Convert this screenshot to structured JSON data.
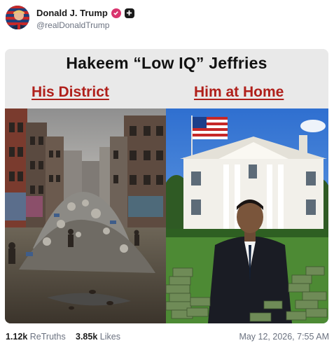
{
  "post": {
    "author_name": "Donald J. Trump",
    "handle": "@realDonaldTrump",
    "verified_icon": "verified-badge-icon",
    "platform_icon": "truth-social-icon"
  },
  "meme": {
    "title": "Hakeem “Low IQ” Jeffries",
    "left_caption": "His District",
    "right_caption": "Him at Home"
  },
  "stats": {
    "retruths_count": "1.12k",
    "retruths_label": "ReTruths",
    "likes_count": "3.85k",
    "likes_label": "Likes",
    "timestamp": "May 12, 2026, 7:55 AM"
  },
  "colors": {
    "caption_red": "#b0201b",
    "badge_pink": "#d9346e",
    "muted_text": "#6b7280"
  }
}
